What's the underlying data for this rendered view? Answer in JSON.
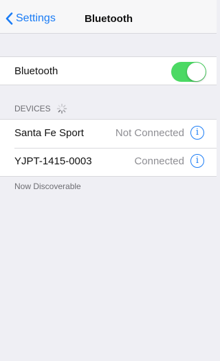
{
  "navbar": {
    "back_label": "Settings",
    "title": "Bluetooth"
  },
  "bluetooth_row": {
    "label": "Bluetooth",
    "toggle_on": true
  },
  "devices_section": {
    "header": "DEVICES"
  },
  "devices": [
    {
      "name": "Santa Fe Sport",
      "status": "Not Connected",
      "info_icon": "i"
    },
    {
      "name": "YJPT-1415-0003",
      "status": "Connected",
      "info_icon": "i"
    }
  ],
  "footer_note": "Now Discoverable",
  "colors": {
    "accent": "#1a7cf5",
    "toggle_on": "#4cd964",
    "background": "#efeff4"
  }
}
